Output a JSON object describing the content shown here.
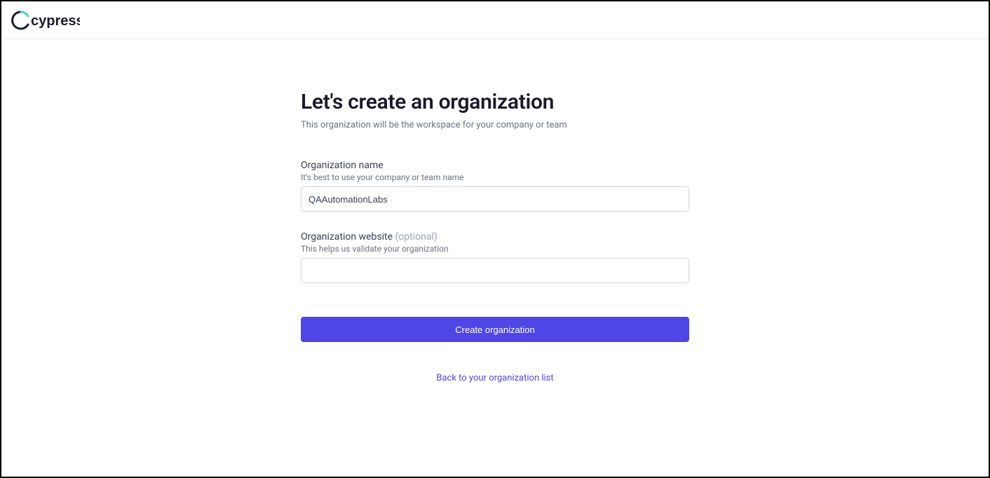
{
  "header": {
    "brand": "cypress"
  },
  "page": {
    "title": "Let's create an organization",
    "subtitle": "This organization will be the workspace for your company or team"
  },
  "form": {
    "org_name": {
      "label": "Organization name",
      "help": "It's best to use your company or team name",
      "value": "QAAutomationLabs"
    },
    "org_website": {
      "label": "Organization website ",
      "optional_tag": "(optional)",
      "help": "This helps us validate your organization",
      "value": ""
    },
    "submit_label": "Create organization",
    "back_link_label": "Back to your organization list"
  }
}
